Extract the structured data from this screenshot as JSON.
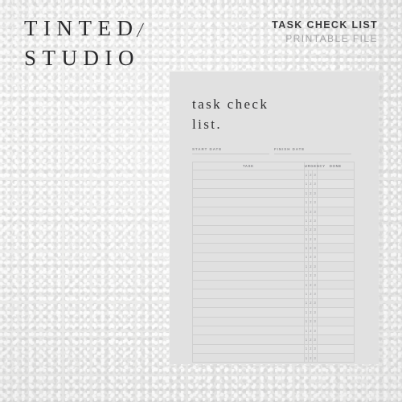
{
  "brand": {
    "line1": "TINTED",
    "line2": "STUDIO",
    "slash_icon": "diagonal-slash-icon"
  },
  "header": {
    "title": "TASK CHECK LIST",
    "subtitle": "PRINTABLE FILE"
  },
  "sheet": {
    "doc_title_line1": "task check",
    "doc_title_line2": "list.",
    "start_date_label": "START DATE",
    "finish_date_label": "FINISH DATE",
    "table": {
      "headers": {
        "task": "TASK",
        "urgency": "URGENCY",
        "done": "DONE"
      },
      "urgency_levels": [
        "1",
        "2",
        "3"
      ],
      "row_count": 21,
      "rows": [
        {
          "task": "",
          "urgency": [
            "1",
            "2",
            "3"
          ],
          "done": ""
        },
        {
          "task": "",
          "urgency": [
            "1",
            "2",
            "3"
          ],
          "done": ""
        },
        {
          "task": "",
          "urgency": [
            "1",
            "2",
            "3"
          ],
          "done": ""
        },
        {
          "task": "",
          "urgency": [
            "1",
            "2",
            "3"
          ],
          "done": ""
        },
        {
          "task": "",
          "urgency": [
            "1",
            "2",
            "3"
          ],
          "done": ""
        },
        {
          "task": "",
          "urgency": [
            "1",
            "2",
            "3"
          ],
          "done": ""
        },
        {
          "task": "",
          "urgency": [
            "1",
            "2",
            "3"
          ],
          "done": ""
        },
        {
          "task": "",
          "urgency": [
            "1",
            "2",
            "3"
          ],
          "done": ""
        },
        {
          "task": "",
          "urgency": [
            "1",
            "2",
            "3"
          ],
          "done": ""
        },
        {
          "task": "",
          "urgency": [
            "1",
            "2",
            "3"
          ],
          "done": ""
        },
        {
          "task": "",
          "urgency": [
            "1",
            "2",
            "3"
          ],
          "done": ""
        },
        {
          "task": "",
          "urgency": [
            "1",
            "2",
            "3"
          ],
          "done": ""
        },
        {
          "task": "",
          "urgency": [
            "1",
            "2",
            "3"
          ],
          "done": ""
        },
        {
          "task": "",
          "urgency": [
            "1",
            "2",
            "3"
          ],
          "done": ""
        },
        {
          "task": "",
          "urgency": [
            "1",
            "2",
            "3"
          ],
          "done": ""
        },
        {
          "task": "",
          "urgency": [
            "1",
            "2",
            "3"
          ],
          "done": ""
        },
        {
          "task": "",
          "urgency": [
            "1",
            "2",
            "3"
          ],
          "done": ""
        },
        {
          "task": "",
          "urgency": [
            "1",
            "2",
            "3"
          ],
          "done": ""
        },
        {
          "task": "",
          "urgency": [
            "1",
            "2",
            "3"
          ],
          "done": ""
        },
        {
          "task": "",
          "urgency": [
            "1",
            "2",
            "3"
          ],
          "done": ""
        },
        {
          "task": "",
          "urgency": [
            "1",
            "2",
            "3"
          ],
          "done": ""
        }
      ]
    }
  },
  "colors": {
    "background": "#ececeb",
    "sheet": "#e1e1e1",
    "ink": "#2e2e30",
    "muted": "#a6a6a8",
    "rule": "#cfcfcf"
  }
}
